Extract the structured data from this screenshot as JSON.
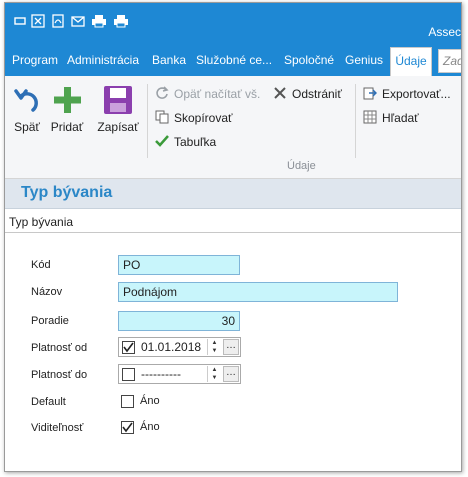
{
  "window": {
    "app_title": "Assec"
  },
  "quick_access": [
    "minimize-icon",
    "excel-icon",
    "pdf-icon",
    "mail-icon",
    "print-icon",
    "print-preview-icon"
  ],
  "menu": {
    "items": [
      "Program",
      "Administrácia",
      "Banka",
      "Služobné ce...",
      "Spoločné",
      "Genius"
    ],
    "active_tab": "Údaje",
    "search_placeholder": "Zad"
  },
  "ribbon": {
    "back": "Späť",
    "add": "Pridať",
    "save": "Zapísať",
    "reload": "Opäť načítať vš.",
    "delete": "Odstrániť",
    "copy": "Skopírovať",
    "table": "Tabuľka",
    "export": "Exportovať...",
    "find": "Hľadať",
    "group_label": "Údaje"
  },
  "form": {
    "title": "Typ bývania",
    "section": "Typ bývania",
    "labels": {
      "code": "Kód",
      "name": "Názov",
      "order": "Poradie",
      "valid_from": "Platnosť od",
      "valid_to": "Platnosť do",
      "default": "Default",
      "visibility": "Viditeľnosť"
    },
    "values": {
      "code": "PO",
      "name": "Podnájom",
      "order": "30",
      "valid_from": "01.01.2018",
      "valid_from_checked": true,
      "valid_to": "----------",
      "valid_to_checked": false,
      "default_label": "Áno",
      "default_checked": false,
      "visibility_label": "Áno",
      "visibility_checked": true
    }
  },
  "colors": {
    "accent": "#1e88d4",
    "field_bg": "#c8f5fb",
    "title": "#2b87c7"
  }
}
